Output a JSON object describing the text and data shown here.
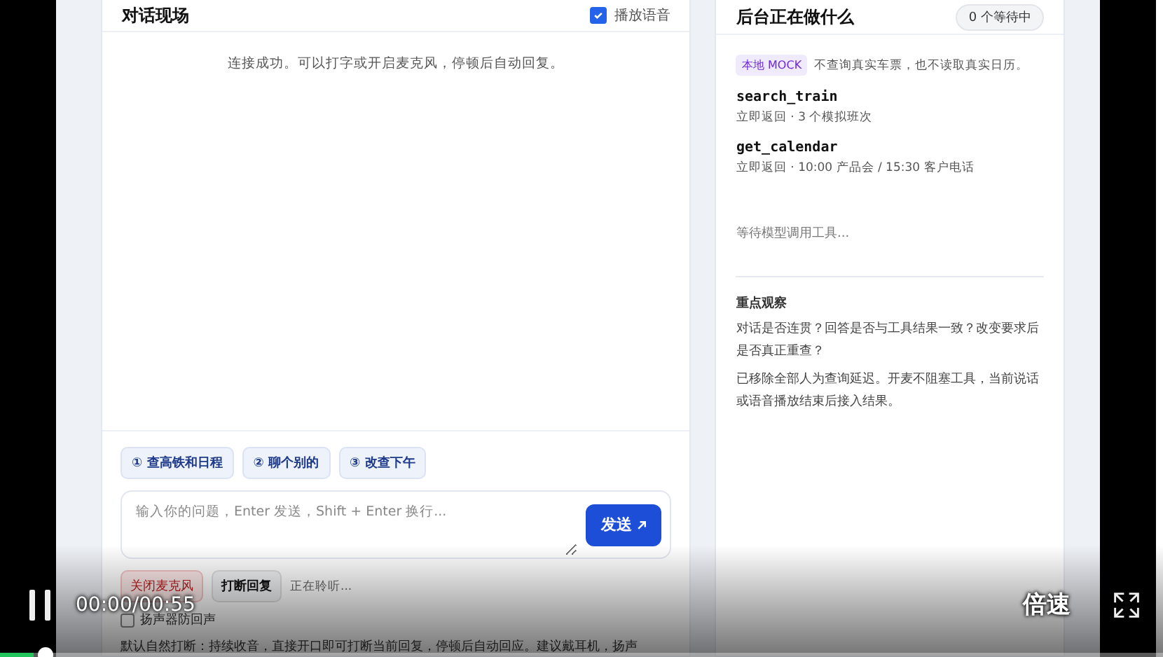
{
  "chat": {
    "title": "对话现场",
    "play_voice": {
      "label": "播放语音",
      "checked": true
    },
    "status": "连接成功。可以打字或开启麦克风，停顿后自动回复。",
    "suggestions": [
      "① 查高铁和日程",
      "② 聊个别的",
      "③ 改查下午"
    ],
    "input": {
      "placeholder": "输入你的问题，Enter 发送，Shift + Enter 换行..."
    },
    "send_button": "发送",
    "mic_button": {
      "label": "关闭麦克风",
      "on": true
    },
    "interrupt_button": "打断回复",
    "listening": "正在聆听...",
    "echo": {
      "label": "扬声器防回声",
      "checked": false
    },
    "note": "默认自然打断：持续收音，直接开口即可打断当前回复，停顿后自动回应。建议戴耳机，扬声"
  },
  "backend": {
    "title": "后台正在做什么",
    "queue_badge": "0 个等待中",
    "mock_tag": "本地 MOCK",
    "mock_note": "不查询真实车票，也不读取真实日历。",
    "tools": [
      {
        "name": "search_train",
        "detail": "立即返回 · 3 个模拟班次"
      },
      {
        "name": "get_calendar",
        "detail": "立即返回 · 10:00 产品会 / 15:30 客户电话"
      }
    ],
    "waiting": "等待模型调用工具...",
    "focus": {
      "title": "重点观察",
      "paragraphs": [
        "对话是否连贯？回答是否与工具结果一致？改变要求后是否真正重查？",
        "已移除全部人为查询延迟。开麦不阻塞工具，当前说话或语音播放结束后接入结果。"
      ]
    }
  },
  "player": {
    "playing": true,
    "time": "00:00/00:55",
    "speed_label": "倍速",
    "level": 0.01
  }
}
